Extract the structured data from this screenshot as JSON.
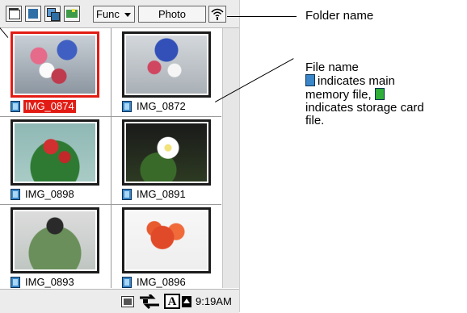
{
  "toolbar": {
    "func_label": "Func",
    "folder_label": "Photo",
    "icons": [
      "grid-view-icon",
      "single-view-icon",
      "slideshow-icon",
      "edit-image-icon",
      "wireless-icon"
    ]
  },
  "files": [
    {
      "name": "IMG_0874",
      "selected": true
    },
    {
      "name": "IMG_0872",
      "selected": false
    },
    {
      "name": "IMG_0898",
      "selected": false
    },
    {
      "name": "IMG_0891",
      "selected": false
    },
    {
      "name": "IMG_0893",
      "selected": false
    },
    {
      "name": "IMG_0896",
      "selected": false
    }
  ],
  "taskbar": {
    "clock": "9:19AM",
    "icons": [
      "cf-card-icon",
      "network-icon",
      "input-method-icon",
      "scroll-up-icon"
    ],
    "input_letter": "A"
  },
  "annotations": {
    "folder_name": "Folder name",
    "file_name_line1": "File name",
    "file_name_line2": "indicates main",
    "file_name_line3": "memory file,",
    "file_name_line4": "indicates storage card",
    "file_name_line5": "file."
  },
  "colors": {
    "selection": "#e21c14",
    "main_memory_icon": "#3a86c8",
    "storage_card_icon": "#2fae3a"
  }
}
